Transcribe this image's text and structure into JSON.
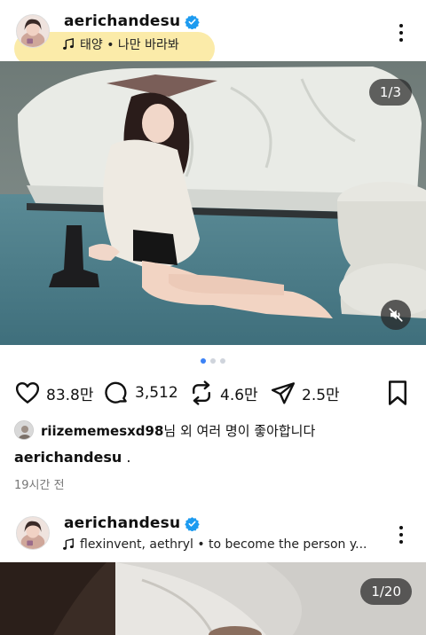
{
  "post1": {
    "username": "aerichandesu",
    "music": "태양 • 나만 바라봐",
    "counter": "1/3",
    "likes": "83.8만",
    "comments": "3,512",
    "reposts": "4.6만",
    "shares": "2.5만",
    "liked_by_user": "riizememesxd98",
    "liked_by_suffix": "님 외 여러 명이 좋아합니다",
    "caption_user": "aerichandesu",
    "caption_text": ".",
    "timestamp": "19시간 전"
  },
  "post2": {
    "username": "aerichandesu",
    "music": "flexinvent, aethryl • to become the person y...",
    "counter": "1/20"
  },
  "colors": {
    "verified_blue": "#1d9bf0",
    "dot_active": "#3b82f6",
    "music_highlight": "#fae48c"
  },
  "icons": [
    "music-note-icon",
    "verified-icon",
    "more-icon",
    "mute-icon",
    "heart-icon",
    "comment-icon",
    "repost-icon",
    "share-icon",
    "bookmark-icon"
  ]
}
